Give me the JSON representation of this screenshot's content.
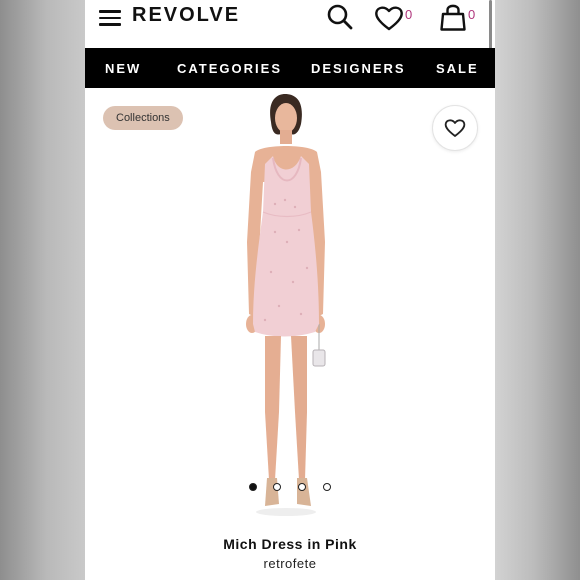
{
  "header": {
    "brand": "REVOLVE",
    "wishlist_count": "0",
    "bag_count": "0"
  },
  "nav": {
    "items": [
      {
        "label": "NEW"
      },
      {
        "label": "CATEGORIES"
      },
      {
        "label": "DESIGNERS"
      },
      {
        "label": "SALE"
      }
    ]
  },
  "product": {
    "tag": "Collections",
    "name": "Mich Dress in Pink",
    "designer": "retrofete",
    "image_count": 4,
    "active_image": 1
  },
  "colors": {
    "nav_background": "#000000",
    "count_accent": "#b0377d",
    "tag_background": "#dcc2b2",
    "dress": "#f1cfd4"
  },
  "icons": [
    "hamburger-menu-icon",
    "search-icon",
    "heart-icon",
    "shopping-bag-icon"
  ]
}
